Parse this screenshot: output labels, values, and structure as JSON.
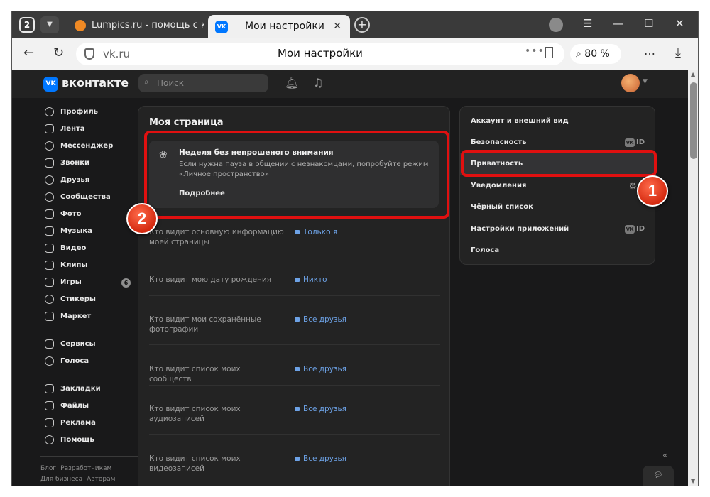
{
  "browser": {
    "tab_count": "2",
    "tabs": [
      {
        "label": "Lumpics.ru - помощь с ко"
      },
      {
        "label": "Мои настройки",
        "favicon": "VK"
      }
    ],
    "address": {
      "url": "vk.ru",
      "page_title": "Мои настройки",
      "zoom": "80 %"
    }
  },
  "vk": {
    "brand": "вконтакте",
    "logo": "VK",
    "search_placeholder": "Поиск",
    "nav": [
      {
        "label": "Профиль",
        "icon": "user-icon"
      },
      {
        "label": "Лента",
        "icon": "feed-icon"
      },
      {
        "label": "Мессенджер",
        "icon": "chat-icon"
      },
      {
        "label": "Звонки",
        "icon": "phone-icon"
      },
      {
        "label": "Друзья",
        "icon": "friends-icon"
      },
      {
        "label": "Сообщества",
        "icon": "groups-icon"
      },
      {
        "label": "Фото",
        "icon": "photo-icon"
      },
      {
        "label": "Музыка",
        "icon": "music-icon"
      },
      {
        "label": "Видео",
        "icon": "video-icon"
      },
      {
        "label": "Клипы",
        "icon": "clips-icon"
      },
      {
        "label": "Игры",
        "icon": "games-icon",
        "badge": "6"
      },
      {
        "label": "Стикеры",
        "icon": "stickers-icon"
      },
      {
        "label": "Маркет",
        "icon": "market-icon"
      },
      {
        "label": "Сервисы",
        "icon": "services-icon"
      },
      {
        "label": "Голоса",
        "icon": "votes-icon"
      },
      {
        "label": "Закладки",
        "icon": "bookmark-icon"
      },
      {
        "label": "Файлы",
        "icon": "files-icon"
      },
      {
        "label": "Реклама",
        "icon": "ads-icon"
      },
      {
        "label": "Помощь",
        "icon": "help-icon"
      }
    ],
    "footer": {
      "blog": "Блог",
      "developers": "Разработчикам",
      "business": "Для бизнеса",
      "authors": "Авторам"
    },
    "main": {
      "title": "Моя страница",
      "banner": {
        "title": "Неделя без непрошеного внимания",
        "text": "Если нужна пауза в общении с незнакомцами, попробуйте режим «Личное пространство»",
        "link": "Подробнее"
      },
      "rows": [
        {
          "question": "Кто видит основную информацию моей страницы",
          "answer": "Только я"
        },
        {
          "question": "Кто видит мою дату рождения",
          "answer": "Никто"
        },
        {
          "question": "Кто видит мои сохранённые фотографии",
          "answer": "Все друзья"
        },
        {
          "question": "Кто видит список моих сообществ",
          "answer": "Все друзья"
        },
        {
          "question": "Кто видит список моих аудиозаписей",
          "answer": "Все друзья"
        },
        {
          "question": "Кто видит список моих видеозаписей",
          "answer": "Все друзья"
        }
      ]
    },
    "settings": [
      {
        "label": "Аккаунт и внешний вид"
      },
      {
        "label": "Безопасность",
        "badge": "ID"
      },
      {
        "label": "Приватность",
        "active": true
      },
      {
        "label": "Уведомления"
      },
      {
        "label": "Чёрный список"
      },
      {
        "label": "Настройки приложений",
        "badge": "ID"
      },
      {
        "label": "Голоса"
      }
    ]
  },
  "annotations": {
    "callout_1": "1",
    "callout_2": "2",
    "highlight_color": "#e01010"
  }
}
